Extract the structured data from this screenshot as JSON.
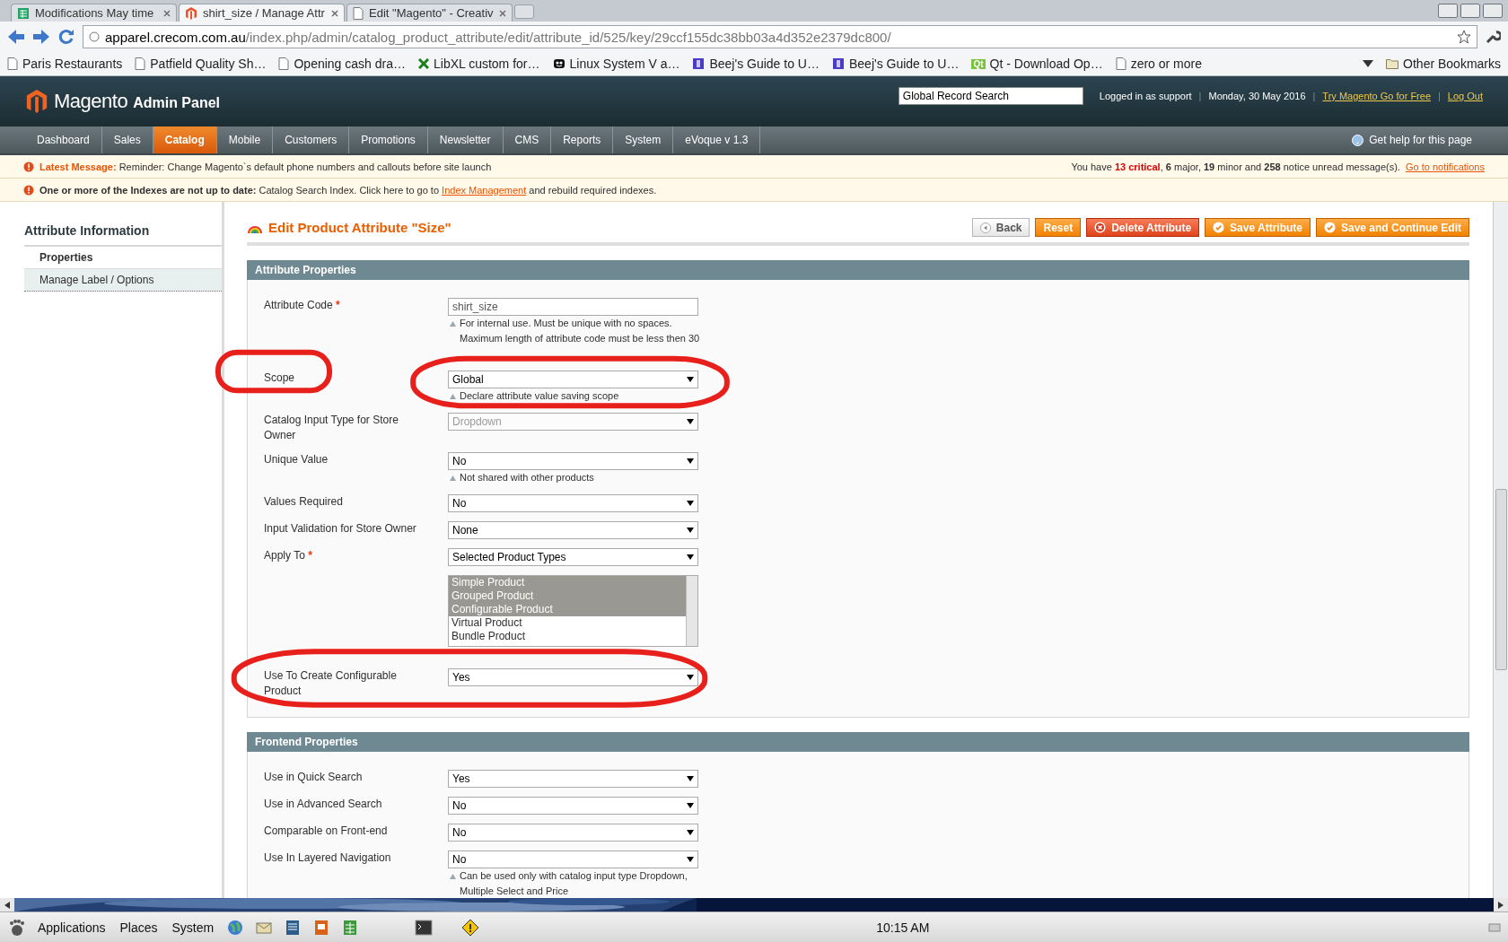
{
  "browser": {
    "tabs": [
      {
        "title": "Modifications May time",
        "kind": "sheet",
        "selected": false
      },
      {
        "title": "shirt_size / Manage Attr",
        "kind": "magento",
        "selected": true
      },
      {
        "title": "Edit \"Magento\" - Creativ",
        "kind": "page",
        "selected": false
      }
    ],
    "url": {
      "host": "apparel.crecom.com.au",
      "path": "/index.php/admin/catalog_product_attribute/edit/attribute_id/525/key/29ccf155dc38bb03a4d352e2379dc800/"
    },
    "bookmarks": [
      {
        "label": "Paris Restaurants",
        "kind": "page"
      },
      {
        "label": "Patfield Quality Sh…",
        "kind": "page"
      },
      {
        "label": "Opening cash dra…",
        "kind": "page"
      },
      {
        "label": "LibXL custom for…",
        "kind": "cross"
      },
      {
        "label": "Linux System V a…",
        "kind": "mascot"
      },
      {
        "label": "Beej's Guide to U…",
        "kind": "book"
      },
      {
        "label": "Beej's Guide to U…",
        "kind": "book"
      },
      {
        "label": "Qt - Download Op…",
        "kind": "qt",
        "icon_text": "Qt"
      },
      {
        "label": "zero or more",
        "kind": "page"
      }
    ],
    "other_bookmarks": "Other Bookmarks"
  },
  "header": {
    "logo": "Magento",
    "subtitle": "Admin Panel",
    "search_value": "Global Record Search",
    "logged_in": "Logged in as support",
    "date": "Monday, 30 May 2016",
    "separators": [
      "|",
      "|",
      "|"
    ],
    "links": [
      "Try Magento Go for Free",
      "Log Out"
    ]
  },
  "nav": {
    "items": [
      {
        "label": "Dashboard",
        "selected": false
      },
      {
        "label": "Sales",
        "selected": false
      },
      {
        "label": "Catalog",
        "selected": true
      },
      {
        "label": "Mobile",
        "selected": false
      },
      {
        "label": "Customers",
        "selected": false
      },
      {
        "label": "Promotions",
        "selected": false
      },
      {
        "label": "Newsletter",
        "selected": false
      },
      {
        "label": "CMS",
        "selected": false
      },
      {
        "label": "Reports",
        "selected": false
      },
      {
        "label": "System",
        "selected": false
      },
      {
        "label": "eVoque v 1.3",
        "selected": false
      }
    ],
    "help": "Get help for this page"
  },
  "messages": {
    "latest_title": "Latest Message:",
    "latest_text": "Reminder: Change Magento`s default phone numbers and callouts before site launch",
    "summary": "You have **13 critical**, **6** major, **19** minor and **258** notice unread message(s).",
    "summary_link": "Go to notifications",
    "index_text": "**One or more of the Indexes are not up to date:** Catalog Search Index. Click here to go to",
    "index_link": "Index Management",
    "index_tail": "and rebuild required indexes."
  },
  "sidebar": {
    "title": "Attribute Information",
    "tabs": [
      {
        "label": "Properties",
        "selected": true
      },
      {
        "label": "Manage Label / Options",
        "selected": false
      }
    ]
  },
  "page_title": "Edit Product Attribute \"Size\"",
  "buttons": [
    {
      "label": "Back",
      "kind": "back"
    },
    {
      "label": "Reset",
      "kind": "reset"
    },
    {
      "label": "Delete Attribute",
      "kind": "delete"
    },
    {
      "label": "Save Attribute",
      "kind": "save"
    },
    {
      "label": "Save and Continue Edit",
      "kind": "save"
    }
  ],
  "sections": [
    {
      "title": "Attribute Properties",
      "fields": [
        {
          "label": "Attribute Code",
          "required_mark": "*",
          "kind": "text",
          "value": "shirt_size",
          "circled": false,
          "notes": [
            "For internal use. Must be unique with no spaces.",
            "Maximum length of attribute code must be less then 30"
          ]
        },
        {
          "label": "Scope",
          "kind": "select",
          "value": "Global",
          "disabled": false,
          "circled": true,
          "notes": [
            "Declare attribute value saving scope"
          ]
        },
        {
          "label": "Catalog Input Type for Store Owner",
          "kind": "select",
          "value": "Dropdown",
          "disabled": true,
          "circled": false
        },
        {
          "label": "Unique Value",
          "kind": "select",
          "value": "No",
          "disabled": false,
          "circled": false,
          "notes": [
            "Not shared with other products"
          ]
        },
        {
          "label": "Values Required",
          "kind": "select",
          "value": "No",
          "disabled": false,
          "circled": false
        },
        {
          "label": "Input Validation for Store Owner",
          "kind": "select",
          "value": "None",
          "disabled": false,
          "circled": false
        },
        {
          "label": "Apply To",
          "required_mark": "*",
          "kind": "select",
          "value": "Selected Product Types",
          "disabled": false,
          "circled": false
        },
        {
          "kind": "multiselect",
          "circled": false,
          "options": [
            {
              "label": "Simple Product",
              "selected": true
            },
            {
              "label": "Grouped Product",
              "selected": true
            },
            {
              "label": "Configurable Product",
              "selected": true
            },
            {
              "label": "Virtual Product",
              "selected": false
            },
            {
              "label": "Bundle Product",
              "selected": false
            }
          ]
        },
        {
          "label": "Use To Create Configurable Product",
          "kind": "select",
          "value": "Yes",
          "disabled": false,
          "circled": true
        }
      ]
    },
    {
      "title": "Frontend Properties",
      "fields": [
        {
          "label": "Use in Quick Search",
          "kind": "select",
          "value": "Yes",
          "disabled": false,
          "circled": false
        },
        {
          "label": "Use in Advanced Search",
          "kind": "select",
          "value": "No",
          "disabled": false,
          "circled": false
        },
        {
          "label": "Comparable on Front-end",
          "kind": "select",
          "value": "No",
          "disabled": false,
          "circled": false
        },
        {
          "label": "Use In Layered Navigation",
          "kind": "select",
          "value": "No",
          "disabled": false,
          "circled": false,
          "notes": [
            "Can be used only with catalog input type Dropdown,",
            "Multiple Select and Price"
          ]
        }
      ]
    }
  ],
  "taskbar": {
    "menus": [
      "Applications",
      "Places",
      "System"
    ],
    "clock": "10:15 AM"
  }
}
